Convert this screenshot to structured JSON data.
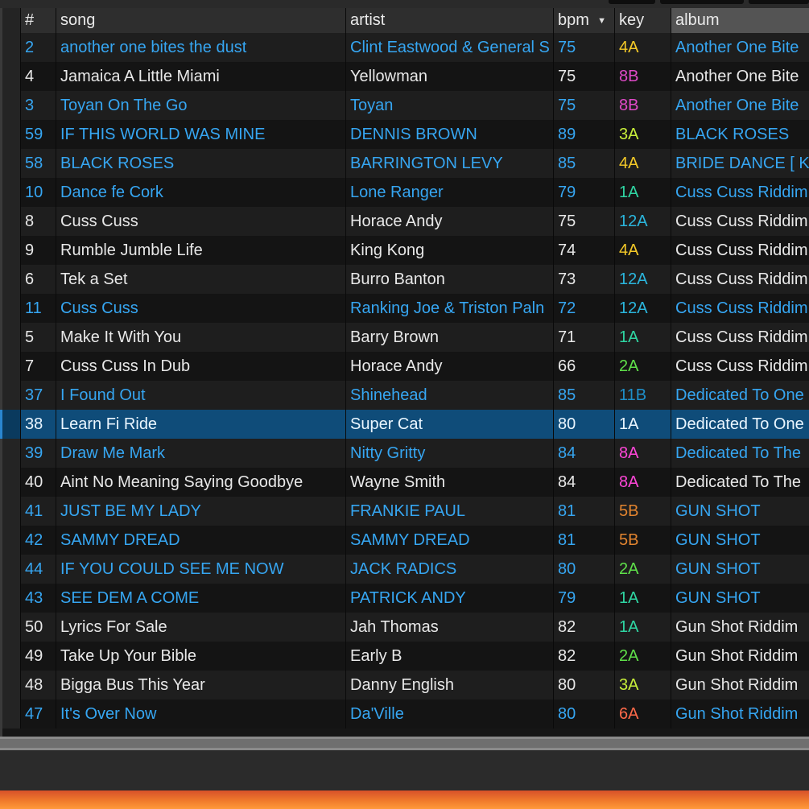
{
  "columns": {
    "num": "#",
    "song": "song",
    "artist": "artist",
    "bpm": "bpm",
    "key": "key",
    "album": "album"
  },
  "sort_indicator": "▼",
  "key_colors": {
    "1A": "#2fd6a3",
    "2A": "#5fe04a",
    "3A": "#c8ef3a",
    "4A": "#f4c928",
    "5B": "#e2842f",
    "6A": "#ff6a4a",
    "8A": "#ff46d8",
    "8B": "#e04ac8",
    "11B": "#1e8fc9",
    "12A": "#2bb6dd"
  },
  "rows": [
    {
      "num": "2",
      "song": "another one bites the dust",
      "artist": "Clint Eastwood & General S",
      "bpm": "75",
      "key": "4A",
      "album": "Another One Bite",
      "style": "blue"
    },
    {
      "num": "4",
      "song": "Jamaica A Little Miami",
      "artist": "Yellowman",
      "bpm": "75",
      "key": "8B",
      "album": "Another One Bite",
      "style": "white"
    },
    {
      "num": "3",
      "song": "Toyan On The Go",
      "artist": "Toyan",
      "bpm": "75",
      "key": "8B",
      "album": "Another One Bite",
      "style": "blue"
    },
    {
      "num": "59",
      "song": "IF THIS WORLD WAS MINE",
      "artist": "DENNIS BROWN",
      "bpm": "89",
      "key": "3A",
      "album": "BLACK ROSES",
      "style": "blue"
    },
    {
      "num": "58",
      "song": "BLACK ROSES",
      "artist": "BARRINGTON LEVY",
      "bpm": "85",
      "key": "4A",
      "album": "BRIDE DANCE [ K",
      "style": "blue"
    },
    {
      "num": "10",
      "song": "Dance fe Cork",
      "artist": "Lone Ranger",
      "bpm": "79",
      "key": "1A",
      "album": "Cuss Cuss Riddim",
      "style": "blue"
    },
    {
      "num": "8",
      "song": "Cuss Cuss",
      "artist": "Horace Andy",
      "bpm": "75",
      "key": "12A",
      "album": "Cuss Cuss Riddim",
      "style": "white"
    },
    {
      "num": "9",
      "song": "Rumble Jumble Life",
      "artist": "King Kong",
      "bpm": "74",
      "key": "4A",
      "album": "Cuss Cuss Riddim",
      "style": "white"
    },
    {
      "num": "6",
      "song": "Tek a Set",
      "artist": "Burro Banton",
      "bpm": "73",
      "key": "12A",
      "album": "Cuss Cuss Riddim",
      "style": "white"
    },
    {
      "num": "11",
      "song": "Cuss Cuss",
      "artist": "Ranking Joe & Triston Paln",
      "bpm": "72",
      "key": "12A",
      "album": "Cuss Cuss Riddim",
      "style": "blue"
    },
    {
      "num": "5",
      "song": "Make It With You",
      "artist": "Barry Brown",
      "bpm": "71",
      "key": "1A",
      "album": "Cuss Cuss Riddim",
      "style": "white"
    },
    {
      "num": "7",
      "song": "Cuss Cuss In Dub",
      "artist": "Horace Andy",
      "bpm": "66",
      "key": "2A",
      "album": "Cuss Cuss Riddim",
      "style": "white"
    },
    {
      "num": "37",
      "song": "I Found Out",
      "artist": "Shinehead",
      "bpm": "85",
      "key": "11B",
      "album": "Dedicated To One",
      "style": "blue"
    },
    {
      "num": "38",
      "song": "Learn Fi Ride",
      "artist": "Super Cat",
      "bpm": "80",
      "key": "1A",
      "album": "Dedicated To One",
      "style": "blue",
      "selected": true
    },
    {
      "num": "39",
      "song": "Draw Me Mark",
      "artist": "Nitty Gritty",
      "bpm": "84",
      "key": "8A",
      "album": "Dedicated To The",
      "style": "blue"
    },
    {
      "num": "40",
      "song": "Aint No Meaning Saying Goodbye",
      "artist": "Wayne Smith",
      "bpm": "84",
      "key": "8A",
      "album": "Dedicated To The",
      "style": "white"
    },
    {
      "num": "41",
      "song": "JUST BE MY LADY",
      "artist": "FRANKIE PAUL",
      "bpm": "81",
      "key": "5B",
      "album": "GUN SHOT",
      "style": "blue"
    },
    {
      "num": "42",
      "song": "SAMMY DREAD",
      "artist": "SAMMY DREAD",
      "bpm": "81",
      "key": "5B",
      "album": "GUN SHOT",
      "style": "blue"
    },
    {
      "num": "44",
      "song": "IF YOU COULD SEE ME NOW",
      "artist": "JACK RADICS",
      "bpm": "80",
      "key": "2A",
      "album": "GUN SHOT",
      "style": "blue"
    },
    {
      "num": "43",
      "song": "SEE DEM A COME",
      "artist": "PATRICK ANDY",
      "bpm": "79",
      "key": "1A",
      "album": "GUN SHOT",
      "style": "blue"
    },
    {
      "num": "50",
      "song": "Lyrics For Sale",
      "artist": "Jah Thomas",
      "bpm": "82",
      "key": "1A",
      "album": "Gun Shot Riddim",
      "style": "white"
    },
    {
      "num": "49",
      "song": "Take Up Your Bible",
      "artist": "Early B",
      "bpm": "82",
      "key": "2A",
      "album": "Gun Shot Riddim",
      "style": "white"
    },
    {
      "num": "48",
      "song": "Bigga Bus This Year",
      "artist": "Danny English",
      "bpm": "80",
      "key": "3A",
      "album": "Gun Shot Riddim",
      "style": "white"
    },
    {
      "num": "47",
      "song": "It's Over Now",
      "artist": "Da'Ville",
      "bpm": "80",
      "key": "6A",
      "album": "Gun Shot Riddim",
      "style": "blue"
    }
  ]
}
